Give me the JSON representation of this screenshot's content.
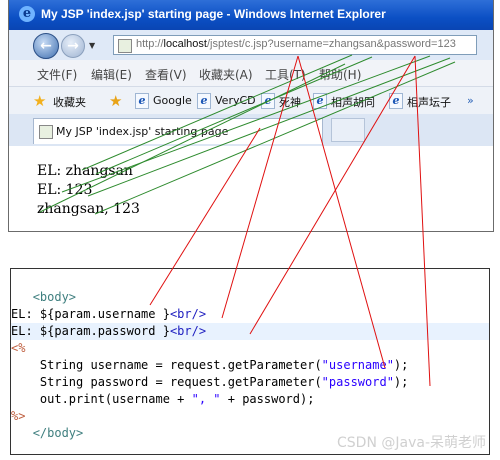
{
  "browser": {
    "title": "My JSP 'index.jsp' starting page - Windows Internet Explorer",
    "address": {
      "prefix": "http://",
      "host": "localhost",
      "path": "/jsptest/c.jsp?username=zhangsan&password=123"
    },
    "menu": [
      "文件(F)",
      "编辑(E)",
      "查看(V)",
      "收藏夹(A)",
      "工具(T)",
      "帮助(H)"
    ],
    "favorites_label": "收藏夹",
    "favorites": [
      "Google",
      "VeryCD",
      "死神",
      "相声胡同",
      "相声坛子"
    ],
    "tab_label": "My JSP 'index.jsp' starting page",
    "content_lines": [
      "EL: zhangsan",
      "EL: 123",
      "zhangsan, 123"
    ]
  },
  "code": {
    "body_open": "<body>",
    "el_username_prefix": "EL: ",
    "el_username_expr": "${param.username }",
    "el_password_prefix": "EL: ",
    "el_password_expr": "${param.password }",
    "br": "<br/>",
    "scriptlet_open": "<%",
    "line_username_pre": "String username = request.getParameter(",
    "line_username_str": "\"username\"",
    "line_password_pre": "String password = request.getParameter(",
    "line_password_str": "\"password\"",
    "line_out_pre": "out.print(username + ",
    "line_out_str": "\", \"",
    "line_out_post": " + password);",
    "stmt_end": ");",
    "scriptlet_close": "%>",
    "body_close": "</body>"
  },
  "watermark": "CSDN @Java-呆萌老师",
  "colors": {
    "annotation_green": "#2e8b2e",
    "annotation_red": "#e01010",
    "titlebar": "#0b4fc4"
  },
  "icons": {
    "back": "back-arrow-icon",
    "forward": "forward-arrow-icon",
    "favorites": "star-icon",
    "add_favorite": "star-plus-icon",
    "favorite_page": "ie-page-icon"
  }
}
